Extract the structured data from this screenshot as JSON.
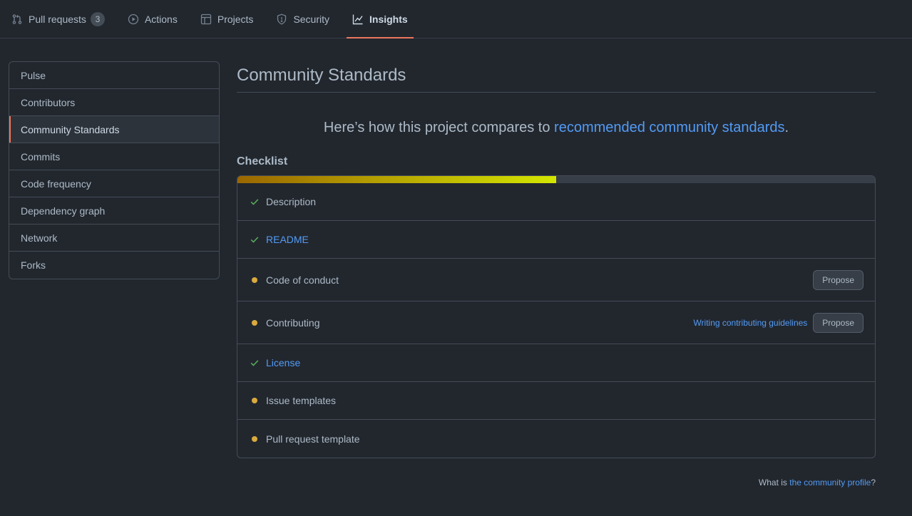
{
  "nav": {
    "tabs": [
      {
        "label": "Pull requests",
        "count": "3",
        "icon": "git-pull-request-icon"
      },
      {
        "label": "Actions",
        "icon": "play-icon"
      },
      {
        "label": "Projects",
        "icon": "table-icon"
      },
      {
        "label": "Security",
        "icon": "shield-icon"
      },
      {
        "label": "Insights",
        "icon": "graph-icon",
        "selected": true
      }
    ]
  },
  "sidebar": {
    "items": [
      {
        "label": "Pulse"
      },
      {
        "label": "Contributors"
      },
      {
        "label": "Community Standards",
        "selected": true
      },
      {
        "label": "Commits"
      },
      {
        "label": "Code frequency"
      },
      {
        "label": "Dependency graph"
      },
      {
        "label": "Network"
      },
      {
        "label": "Forks"
      }
    ]
  },
  "main": {
    "title": "Community Standards",
    "lead_prefix": "Here’s how this project compares to ",
    "lead_link": "recommended community standards",
    "lead_suffix": ".",
    "checklist_title": "Checklist",
    "progress": 0.5,
    "items": [
      {
        "label": "Description",
        "status": "done",
        "link": false
      },
      {
        "label": "README",
        "status": "done",
        "link": true
      },
      {
        "label": "Code of conduct",
        "status": "missing",
        "link": false,
        "button": "Propose"
      },
      {
        "label": "Contributing",
        "status": "missing",
        "link": false,
        "guide": "Writing contributing guidelines",
        "button": "Propose"
      },
      {
        "label": "License",
        "status": "done",
        "link": true
      },
      {
        "label": "Issue templates",
        "status": "missing",
        "link": false
      },
      {
        "label": "Pull request template",
        "status": "missing",
        "link": false
      }
    ],
    "footer_prefix": "What is ",
    "footer_link": "the community profile",
    "footer_suffix": "?"
  },
  "colors": {
    "accent": "#ec775c",
    "check": "#57ab5a",
    "dot": "#daaa3f",
    "link": "#539bf5"
  }
}
